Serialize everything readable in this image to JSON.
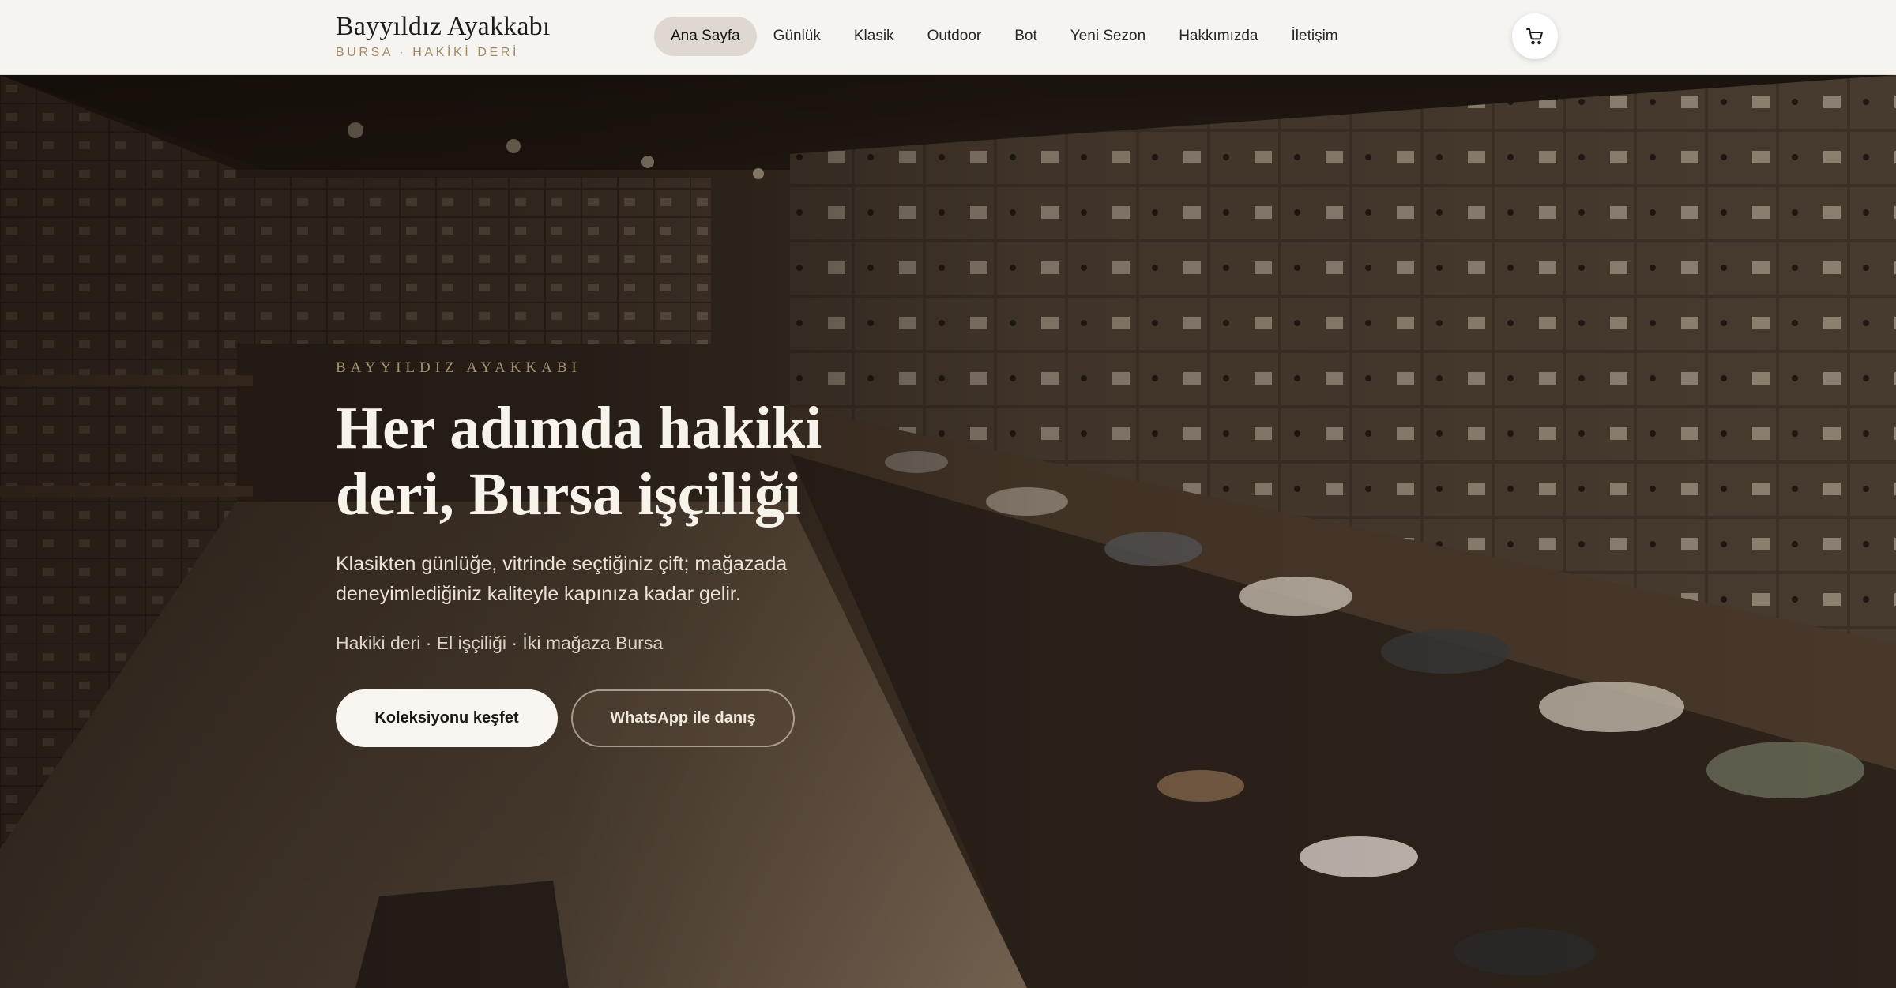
{
  "header": {
    "brand_name": "Bayyıldız Ayakkabı",
    "brand_sub": "BURSA · HAKİKİ DERİ",
    "nav": [
      {
        "label": "Ana Sayfa",
        "active": true
      },
      {
        "label": "Günlük"
      },
      {
        "label": "Klasik"
      },
      {
        "label": "Outdoor"
      },
      {
        "label": "Bot"
      },
      {
        "label": "Yeni Sezon"
      },
      {
        "label": "Hakkımızda"
      },
      {
        "label": "İletişim"
      }
    ],
    "cart_icon": "cart-icon"
  },
  "hero": {
    "eyebrow": "BAYYILDIZ AYAKKABI",
    "headline": "Her adımda hakiki deri, Bursa işçiliği",
    "lead": "Klasikten günlüğe, vitrinde seçtiğiniz çift; mağazada deneyimlediğiniz kaliteyle kapınıza kadar gelir.",
    "features": "Hakiki deri · El işçiliği · İki mağaza Bursa",
    "primary_cta": "Koleksiyonu keşfet",
    "secondary_cta": "WhatsApp ile danış"
  },
  "colors": {
    "header_bg": "#f6f4f1",
    "accent_gold": "#a48a62",
    "hero_text": "#f7f2ea"
  }
}
